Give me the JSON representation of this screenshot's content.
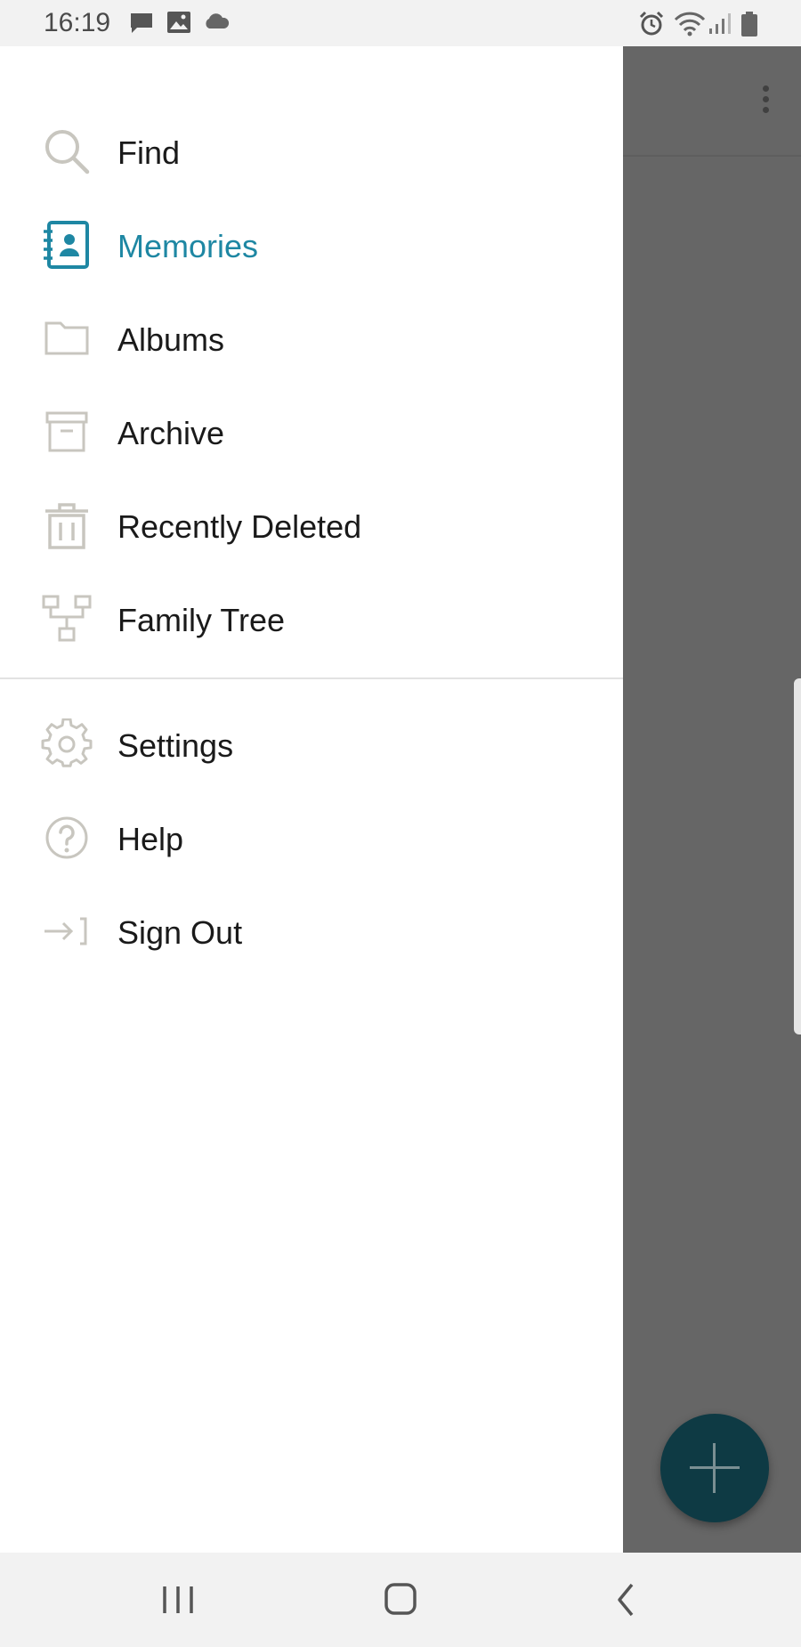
{
  "status_bar": {
    "time": "16:19",
    "left_icons": [
      "message-icon",
      "image-icon",
      "cloud-icon"
    ],
    "right_icons": [
      "alarm-icon",
      "wifi-icon",
      "signal-icon",
      "battery-icon"
    ]
  },
  "drawer": {
    "primary_items": [
      {
        "label": "Find",
        "icon": "search-icon"
      },
      {
        "label": "Memories",
        "icon": "memories-icon",
        "active": true
      },
      {
        "label": "Albums",
        "icon": "folder-icon"
      },
      {
        "label": "Archive",
        "icon": "archive-icon"
      },
      {
        "label": "Recently Deleted",
        "icon": "trash-icon"
      },
      {
        "label": "Family Tree",
        "icon": "family-tree-icon"
      }
    ],
    "secondary_items": [
      {
        "label": "Settings",
        "icon": "gear-icon"
      },
      {
        "label": "Help",
        "icon": "help-icon"
      },
      {
        "label": "Sign Out",
        "icon": "sign-out-icon"
      }
    ]
  },
  "background_app": {
    "fab_icon": "plus-icon",
    "menu_icon": "overflow-menu-icon"
  },
  "nav_bar": {
    "buttons": [
      "recent-apps-icon",
      "home-icon",
      "back-icon"
    ]
  },
  "colors": {
    "accent": "#1e87a3",
    "icon_gray": "#c8c6bf",
    "fab": "#0e3a44",
    "scrim": "#666666"
  }
}
